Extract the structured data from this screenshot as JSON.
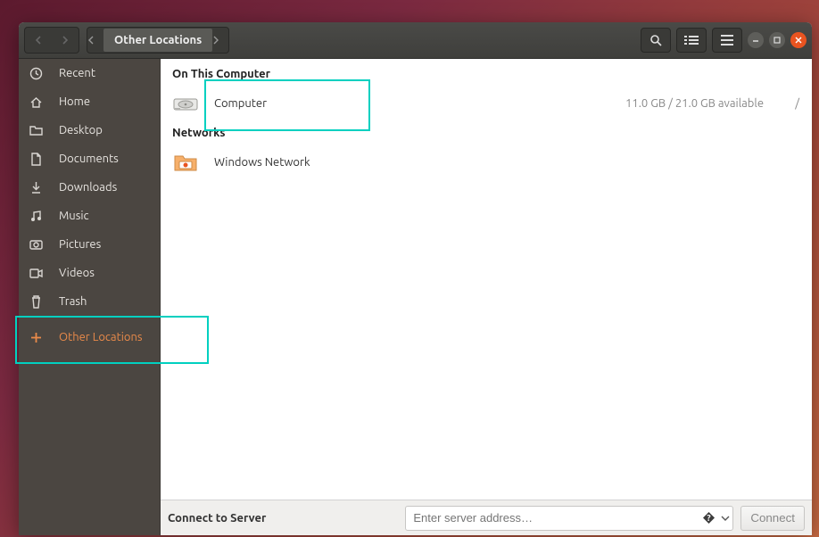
{
  "titlebar": {
    "location": "Other Locations"
  },
  "sidebar": {
    "items": [
      {
        "icon": "clock",
        "label": "Recent"
      },
      {
        "icon": "home",
        "label": "Home"
      },
      {
        "icon": "folder",
        "label": "Desktop"
      },
      {
        "icon": "file",
        "label": "Documents"
      },
      {
        "icon": "download",
        "label": "Downloads"
      },
      {
        "icon": "music",
        "label": "Music"
      },
      {
        "icon": "camera",
        "label": "Pictures"
      },
      {
        "icon": "video",
        "label": "Videos"
      },
      {
        "icon": "trash",
        "label": "Trash"
      },
      {
        "icon": "plus",
        "label": "Other Locations",
        "active": true
      }
    ]
  },
  "sections": {
    "on_this_computer": "On This Computer",
    "networks": "Networks"
  },
  "rows": {
    "computer": {
      "name": "Computer",
      "storage": "11.0 GB / 21.0 GB available",
      "path": "/"
    },
    "windows_network": {
      "name": "Windows Network"
    }
  },
  "connect": {
    "label": "Connect to Server",
    "placeholder": "Enter server address…",
    "button": "Connect"
  }
}
